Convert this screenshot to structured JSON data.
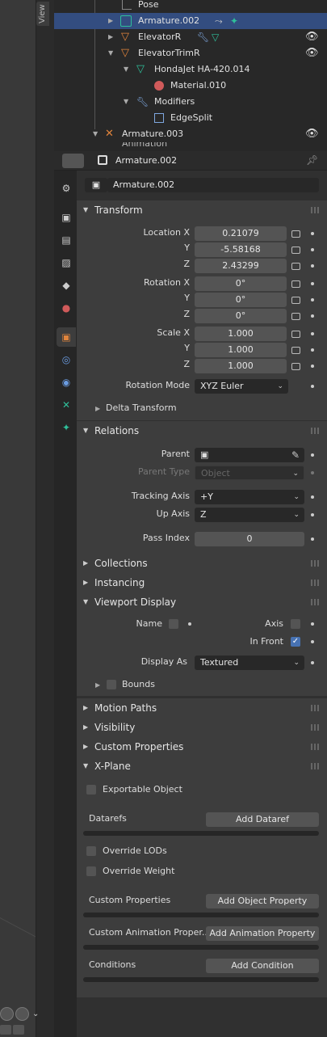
{
  "viewport": {
    "view_tab": "View"
  },
  "outliner": {
    "rows": [
      {
        "label": "Pose"
      },
      {
        "label": "Armature.002"
      },
      {
        "label": "ElevatorR"
      },
      {
        "label": "ElevatorTrimR"
      },
      {
        "label": "HondaJet HA-420.014"
      },
      {
        "label": "Material.010"
      },
      {
        "label": "Modifiers"
      },
      {
        "label": "EdgeSplit"
      },
      {
        "label": "Armature.003"
      },
      {
        "label": "Animation"
      }
    ]
  },
  "header": {
    "object_name": "Armature.002"
  },
  "object": {
    "name_field": "Armature.002"
  },
  "transform": {
    "title": "Transform",
    "location_label": "Location X",
    "y_label": "Y",
    "z_label": "Z",
    "location": [
      "0.21079",
      "-5.58168",
      "2.43299"
    ],
    "rotation_label": "Rotation X",
    "rotation": [
      "0°",
      "0°",
      "0°"
    ],
    "scale_label": "Scale X",
    "scale": [
      "1.000",
      "1.000",
      "1.000"
    ],
    "rotation_mode_label": "Rotation Mode",
    "rotation_mode": "XYZ Euler",
    "delta": "Delta Transform"
  },
  "relations": {
    "title": "Relations",
    "parent_label": "Parent",
    "parent_type_label": "Parent Type",
    "parent_type": "Object",
    "tracking_axis_label": "Tracking Axis",
    "tracking_axis": "+Y",
    "up_axis_label": "Up Axis",
    "up_axis": "Z",
    "pass_index_label": "Pass Index",
    "pass_index": "0"
  },
  "collapsed": {
    "collections": "Collections",
    "instancing": "Instancing"
  },
  "viewport_display": {
    "title": "Viewport Display",
    "name_label": "Name",
    "axis_label": "Axis",
    "in_front_label": "In Front",
    "display_as_label": "Display As",
    "display_as": "Textured",
    "bounds_label": "Bounds"
  },
  "more_panels": {
    "motion_paths": "Motion Paths",
    "visibility": "Visibility",
    "custom_properties": "Custom Properties"
  },
  "xplane": {
    "title": "X-Plane",
    "exportable": "Exportable Object",
    "datarefs_label": "Datarefs",
    "add_dataref": "Add Dataref",
    "override_lods": "Override LODs",
    "override_weight": "Override Weight",
    "custom_props_label": "Custom Properties",
    "add_object_property": "Add Object Property",
    "custom_anim_label": "Custom Animation Proper..",
    "add_animation_property": "Add Animation Property",
    "conditions_label": "Conditions",
    "add_condition": "Add Condition"
  },
  "colors": {
    "accent": "#4772b3",
    "selected_row": "#334d80",
    "object_orange": "#e0843c",
    "armature_teal": "#2fbf9a"
  }
}
